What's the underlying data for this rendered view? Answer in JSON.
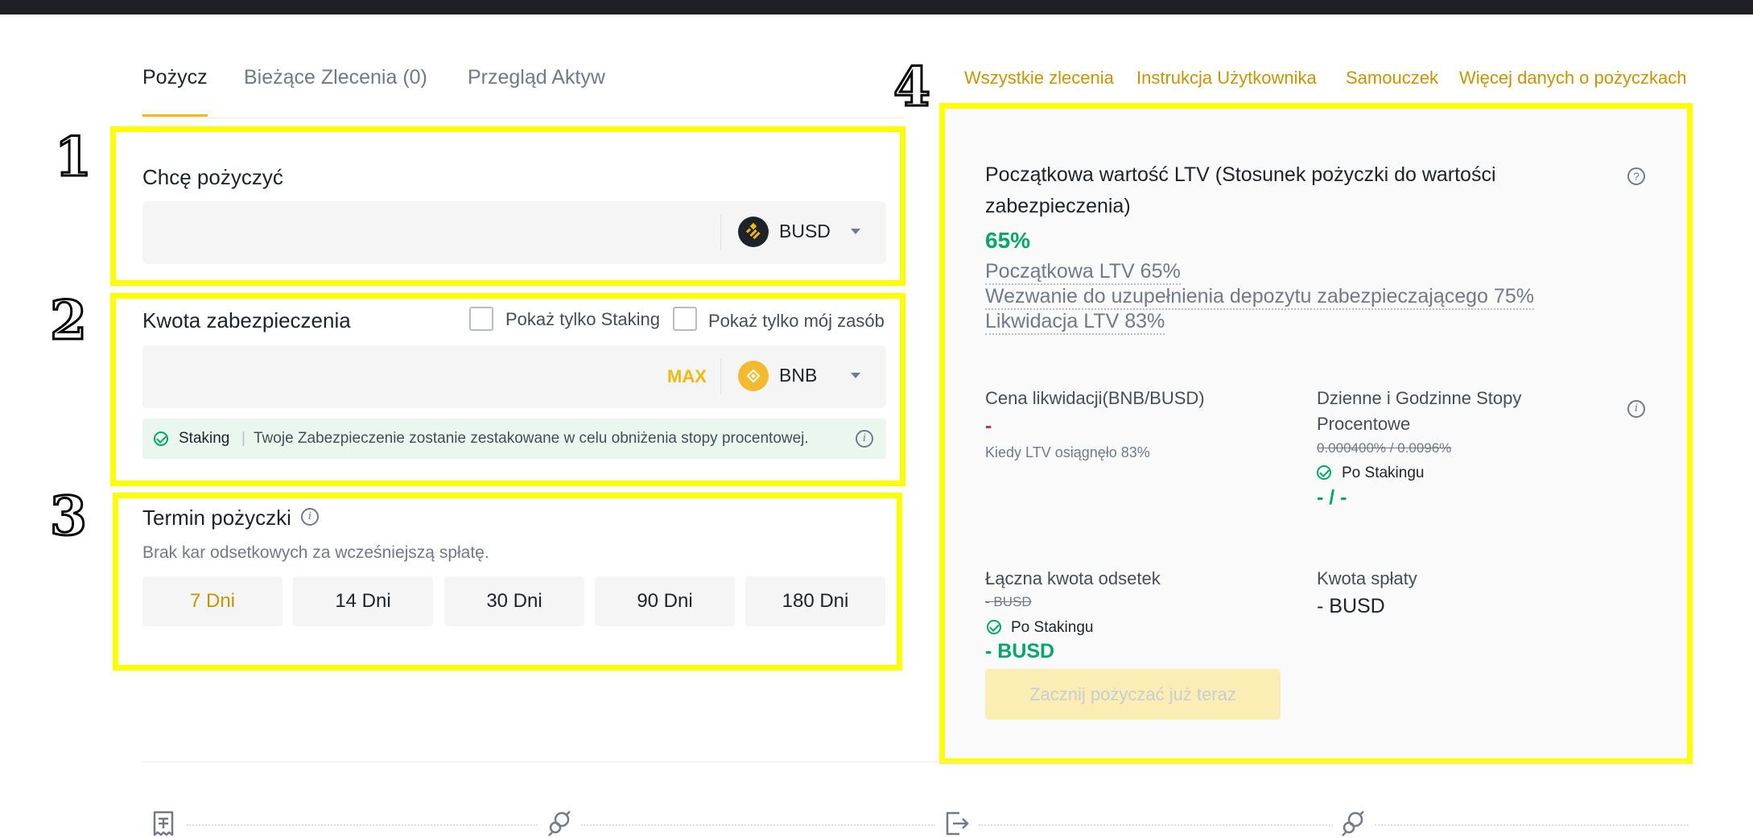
{
  "tabs": [
    {
      "label": "Pożycz"
    },
    {
      "label": "Bieżące Zlecenia (0)"
    },
    {
      "label": "Przegląd Aktyw"
    }
  ],
  "links": [
    "Wszystkie zlecenia",
    "Instrukcja Użytkownika",
    "Samouczek",
    "Więcej danych o pożyczkach"
  ],
  "annotations": [
    "1",
    "2",
    "3",
    "4"
  ],
  "borrow": {
    "label": "Chcę pożyczyć",
    "coin": "BUSD",
    "coin_icon": "busd-icon"
  },
  "collateral": {
    "label": "Kwota zabezpieczenia",
    "checkbox_staking": "Pokaż tylko Staking",
    "checkbox_mine": "Pokaż tylko mój zasób",
    "max": "MAX",
    "coin": "BNB",
    "coin_icon": "bnb-icon",
    "staking_tag": "Staking",
    "staking_text": "Twoje Zabezpieczenie zostanie zestakowane w celu obniżenia stopy procentowej."
  },
  "term": {
    "label": "Termin pożyczki",
    "note": "Brak kar odsetkowych za wcześniejszą spłatę.",
    "options": [
      "7 Dni",
      "14 Dni",
      "30 Dni",
      "90 Dni",
      "180 Dni"
    ],
    "selected": "7 Dni"
  },
  "summary": {
    "ltv_title_line1": "Początkowa wartość LTV (Stosunek pożyczki do wartości",
    "ltv_title_line2": "zabezpieczenia)",
    "ltv_value": "65%",
    "initial_ltv": "Początkowa LTV 65%",
    "margin_call": "Wezwanie do uzupełnienia depozytu zabezpieczającego 75%",
    "liquidation_ltv": "Likwidacja LTV 83%",
    "liq_price_title": "Cena likwidacji(BNB/BUSD)",
    "liq_price_value": "-",
    "liq_price_note": "Kiedy LTV osiągnęło 83%",
    "rates_title_line1": "Dzienne i Godzinne Stopy",
    "rates_title_line2": "Procentowe",
    "rates_old": "0.000400% / 0.0096%",
    "after_staking": "Po Stakingu",
    "rates_value": "- / -",
    "interest_title": "Łączna kwota odsetek",
    "interest_old": "- BUSD",
    "interest_value": "- BUSD",
    "repay_title": "Kwota spłaty",
    "repay_value": "- BUSD",
    "button": "Zacznij pożyczać już teraz"
  },
  "colors": {
    "accent": "#f0b90b",
    "link": "#c99400",
    "green": "#03a66d",
    "red": "#cf304a",
    "annotation": "#ffff00"
  }
}
